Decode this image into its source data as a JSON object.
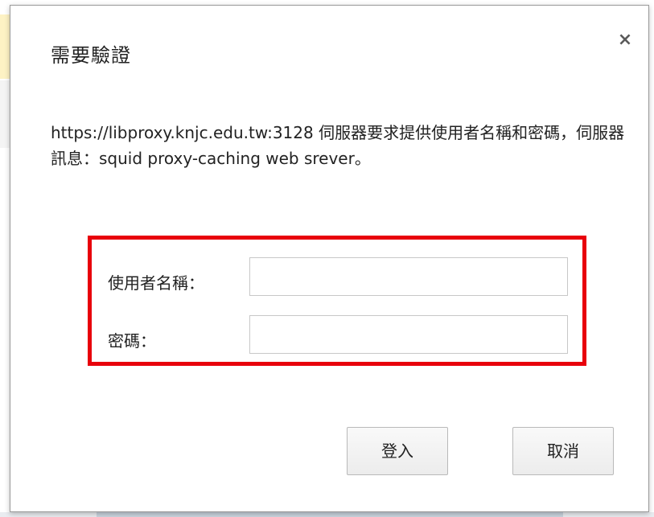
{
  "dialog": {
    "title": "需要驗證",
    "close_label": "×",
    "message": "https://libproxy.knjc.edu.tw:3128 伺服器要求提供使用者名稱和密碼，伺服器訊息：squid proxy-caching web srever。"
  },
  "form": {
    "username_label": "使用者名稱：",
    "username_value": "",
    "password_label": "密碼：",
    "password_value": ""
  },
  "buttons": {
    "login_label": "登入",
    "cancel_label": "取消"
  },
  "colors": {
    "highlight_border": "#e8000b",
    "background_left_strip": "#fdf2c4"
  }
}
